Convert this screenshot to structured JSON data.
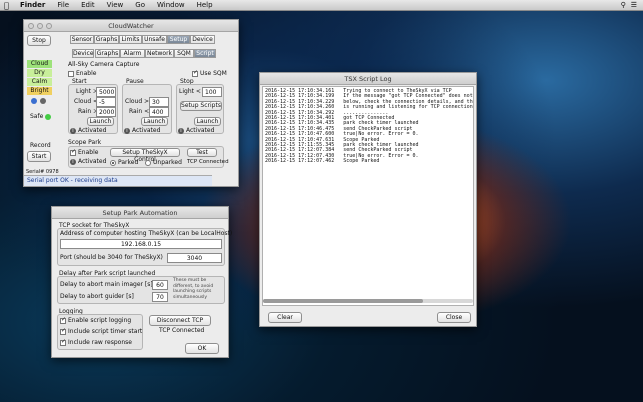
{
  "menubar": {
    "app": "Finder",
    "items": [
      "File",
      "Edit",
      "View",
      "Go",
      "Window",
      "Help"
    ]
  },
  "cloudwatcher": {
    "title": "CloudWatcher",
    "stop_label": "Stop",
    "statuses": [
      "Cloud",
      "Dry",
      "Calm",
      "Bright"
    ],
    "safe_label": "Safe",
    "record_label": "Record",
    "start_label": "Start",
    "serial_label": "Serial# 0978",
    "status_bar": "Serial port OK - receiving data",
    "tabs_top": [
      "Sensor",
      "Graphs",
      "Limits",
      "Unsafe",
      "Setup",
      "Device"
    ],
    "tabs_sub": [
      "Device",
      "Graphs",
      "Alarm",
      "Network",
      "SQM",
      "Script"
    ],
    "allsky_title": "All-Sky Camera Capture",
    "enable_label": "Enable",
    "use_sqm_label": "Use SQM",
    "start_col": "Start",
    "pause_col": "Pause",
    "stop_col": "Stop",
    "light_label": "Light >",
    "light_value": "5000",
    "cloud_label": "Cloud <",
    "cloud_value": "-5",
    "rain_label": "Rain >",
    "rain_value": "2000",
    "pause_cloud_label": "Cloud >",
    "pause_cloud_value": "30",
    "pause_rain_label": "Rain <",
    "pause_rain_value": "400",
    "stop_light_label": "Light <",
    "stop_light_value": "100",
    "setup_scripts_label": "Setup Scripts",
    "launch_label": "Launch",
    "activated_label": "Activated",
    "scope_park_title": "Scope Park",
    "setup_thesky_label": "Setup TheSkyX Control",
    "test_label": "Test",
    "parked_label": "Parked",
    "unparked_label": "Unparked",
    "tcp_connected": "TCP Connected"
  },
  "tsxlog": {
    "title": "TSX Script Log",
    "lines": [
      "2016-12-15 17:10:34.161   Trying to connect to TheSkyX via TCP",
      "2016-12-15 17:10:34.199   If the message \"got TCP Connected\" does not appear",
      "2016-12-15 17:10:34.229   below, check the connection details, and that TheSkyX",
      "2016-12-15 17:10:34.260   is running and listening for TCP connections.",
      "2016-12-15 17:10:34.292   ...............",
      "2016-12-15 17:10:34.401   got TCP Connected",
      "2016-12-15 17:10:34.435   park check timer launched",
      "2016-12-15 17:10:46.475   send CheckParked script",
      "2016-12-15 17:10:47.600   true|No error. Error = 0.",
      "2016-12-15 17:10:47.631   Scope Parked",
      "2016-12-15 17:11:55.345   park check timer launched",
      "2016-12-15 17:12:07.384   send CheckParked script",
      "2016-12-15 17:12:07.430   true|No error. Error = 0.",
      "2016-12-15 17:12:07.462   Scope Parked"
    ],
    "clear_label": "Clear",
    "close_label": "Close"
  },
  "park": {
    "title": "Setup Park Automation",
    "tcp_title": "TCP socket for TheSkyX",
    "address_label": "Address of computer hosting TheSkyX (can be LocalHost)",
    "address_value": "192.168.0.15",
    "port_label": "Port (should be 3040 for TheSkyX)",
    "port_value": "3040",
    "delay_title": "Delay after Park script launched",
    "delay_main_label": "Delay to abort main imager [s]",
    "delay_main_value": "60",
    "delay_guider_label": "Delay to abort guider [s]",
    "delay_guider_value": "70",
    "delay_note": "These must be different, to avoid launching scripts simultaneously",
    "logging_title": "Logging",
    "log1": "Enable script logging",
    "log2": "Include script timer start",
    "log3": "Include raw response",
    "disconnect_label": "Disconnect TCP",
    "tcp_connected": "TCP Connected",
    "ok_label": "OK"
  }
}
